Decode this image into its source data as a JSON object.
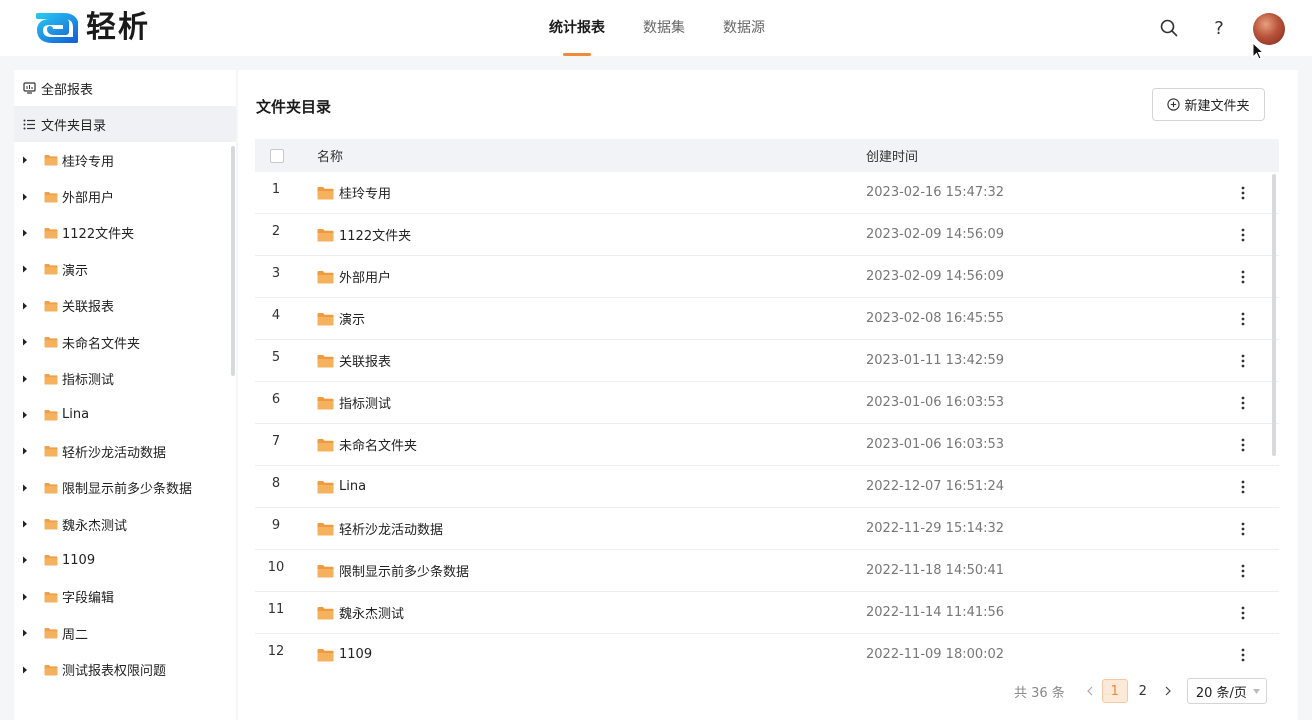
{
  "app": {
    "name": "轻析"
  },
  "nav": {
    "tabs": [
      {
        "label": "统计报表",
        "active": true
      },
      {
        "label": "数据集",
        "active": false
      },
      {
        "label": "数据源",
        "active": false
      }
    ]
  },
  "header_icons": [
    "search-icon",
    "help-icon",
    "avatar"
  ],
  "sidebar": {
    "all_reports": "全部报表",
    "folder_dir": "文件夹目录",
    "tree": [
      "桂玲专用",
      "外部用户",
      "1122文件夹",
      "演示",
      "关联报表",
      "未命名文件夹",
      "指标测试",
      "Lina",
      "轻析沙龙活动数据",
      "限制显示前多少条数据",
      "魏永杰测试",
      "1109",
      "字段编辑",
      "周二",
      "测试报表权限问题"
    ]
  },
  "main": {
    "title": "文件夹目录",
    "new_folder_label": "新建文件夹",
    "columns": {
      "name": "名称",
      "created": "创建时间"
    },
    "rows": [
      {
        "index": "1",
        "name": "桂玲专用",
        "created": "2023-02-16 15:47:32"
      },
      {
        "index": "2",
        "name": "1122文件夹",
        "created": "2023-02-09 14:56:09"
      },
      {
        "index": "3",
        "name": "外部用户",
        "created": "2023-02-09 14:56:09"
      },
      {
        "index": "4",
        "name": "演示",
        "created": "2023-02-08 16:45:55"
      },
      {
        "index": "5",
        "name": "关联报表",
        "created": "2023-01-11 13:42:59"
      },
      {
        "index": "6",
        "name": "指标测试",
        "created": "2023-01-06 16:03:53"
      },
      {
        "index": "7",
        "name": "未命名文件夹",
        "created": "2023-01-06 16:03:53"
      },
      {
        "index": "8",
        "name": "Lina",
        "created": "2022-12-07 16:51:24"
      },
      {
        "index": "9",
        "name": "轻析沙龙活动数据",
        "created": "2022-11-29 15:14:32"
      },
      {
        "index": "10",
        "name": "限制显示前多少条数据",
        "created": "2022-11-18 14:50:41"
      },
      {
        "index": "11",
        "name": "魏永杰测试",
        "created": "2022-11-14 11:41:56"
      },
      {
        "index": "12",
        "name": "1109",
        "created": "2022-11-09 18:00:02"
      }
    ]
  },
  "pagination": {
    "total": "共 36 条",
    "pages": [
      "1",
      "2"
    ],
    "current": "1",
    "page_size": "20 条/页"
  },
  "colors": {
    "accent": "#ef8a3a",
    "folder": "#f0a04b",
    "logo_blue": "#1aa7e8"
  }
}
